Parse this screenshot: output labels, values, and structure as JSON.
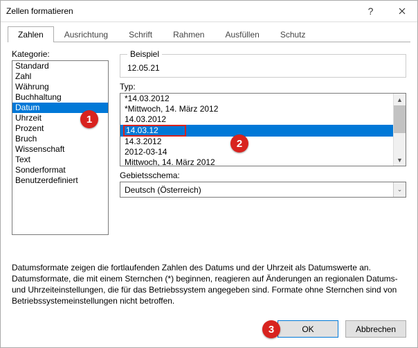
{
  "window": {
    "title": "Zellen formatieren"
  },
  "tabs": {
    "items": [
      "Zahlen",
      "Ausrichtung",
      "Schrift",
      "Rahmen",
      "Ausfüllen",
      "Schutz"
    ],
    "active": 0
  },
  "category": {
    "label": "Kategorie:",
    "items": [
      "Standard",
      "Zahl",
      "Währung",
      "Buchhaltung",
      "Datum",
      "Uhrzeit",
      "Prozent",
      "Bruch",
      "Wissenschaft",
      "Text",
      "Sonderformat",
      "Benutzerdefiniert"
    ],
    "selected": 4
  },
  "example": {
    "label": "Beispiel",
    "value": "12.05.21"
  },
  "type": {
    "label": "Typ:",
    "items": [
      "*14.03.2012",
      "*Mittwoch, 14. März 2012",
      "14.03.2012",
      "14.03.12",
      "14.3.2012",
      "2012-03-14",
      "Mittwoch, 14. März 2012"
    ],
    "selected": 3
  },
  "locale": {
    "label": "Gebietsschema:",
    "value": "Deutsch (Österreich)"
  },
  "description": "Datumsformate zeigen die fortlaufenden Zahlen des Datums und der Uhrzeit als Datumswerte an. Datumsformate, die mit einem Sternchen (*) beginnen, reagieren auf Änderungen an regionalen Datums- und Uhrzeiteinstellungen, die für das Betriebssystem angegeben sind. Formate ohne Sternchen sind von Betriebssystemeinstellungen nicht betroffen.",
  "buttons": {
    "ok": "OK",
    "cancel": "Abbrechen"
  },
  "markers": {
    "m1": "1",
    "m2": "2",
    "m3": "3"
  }
}
